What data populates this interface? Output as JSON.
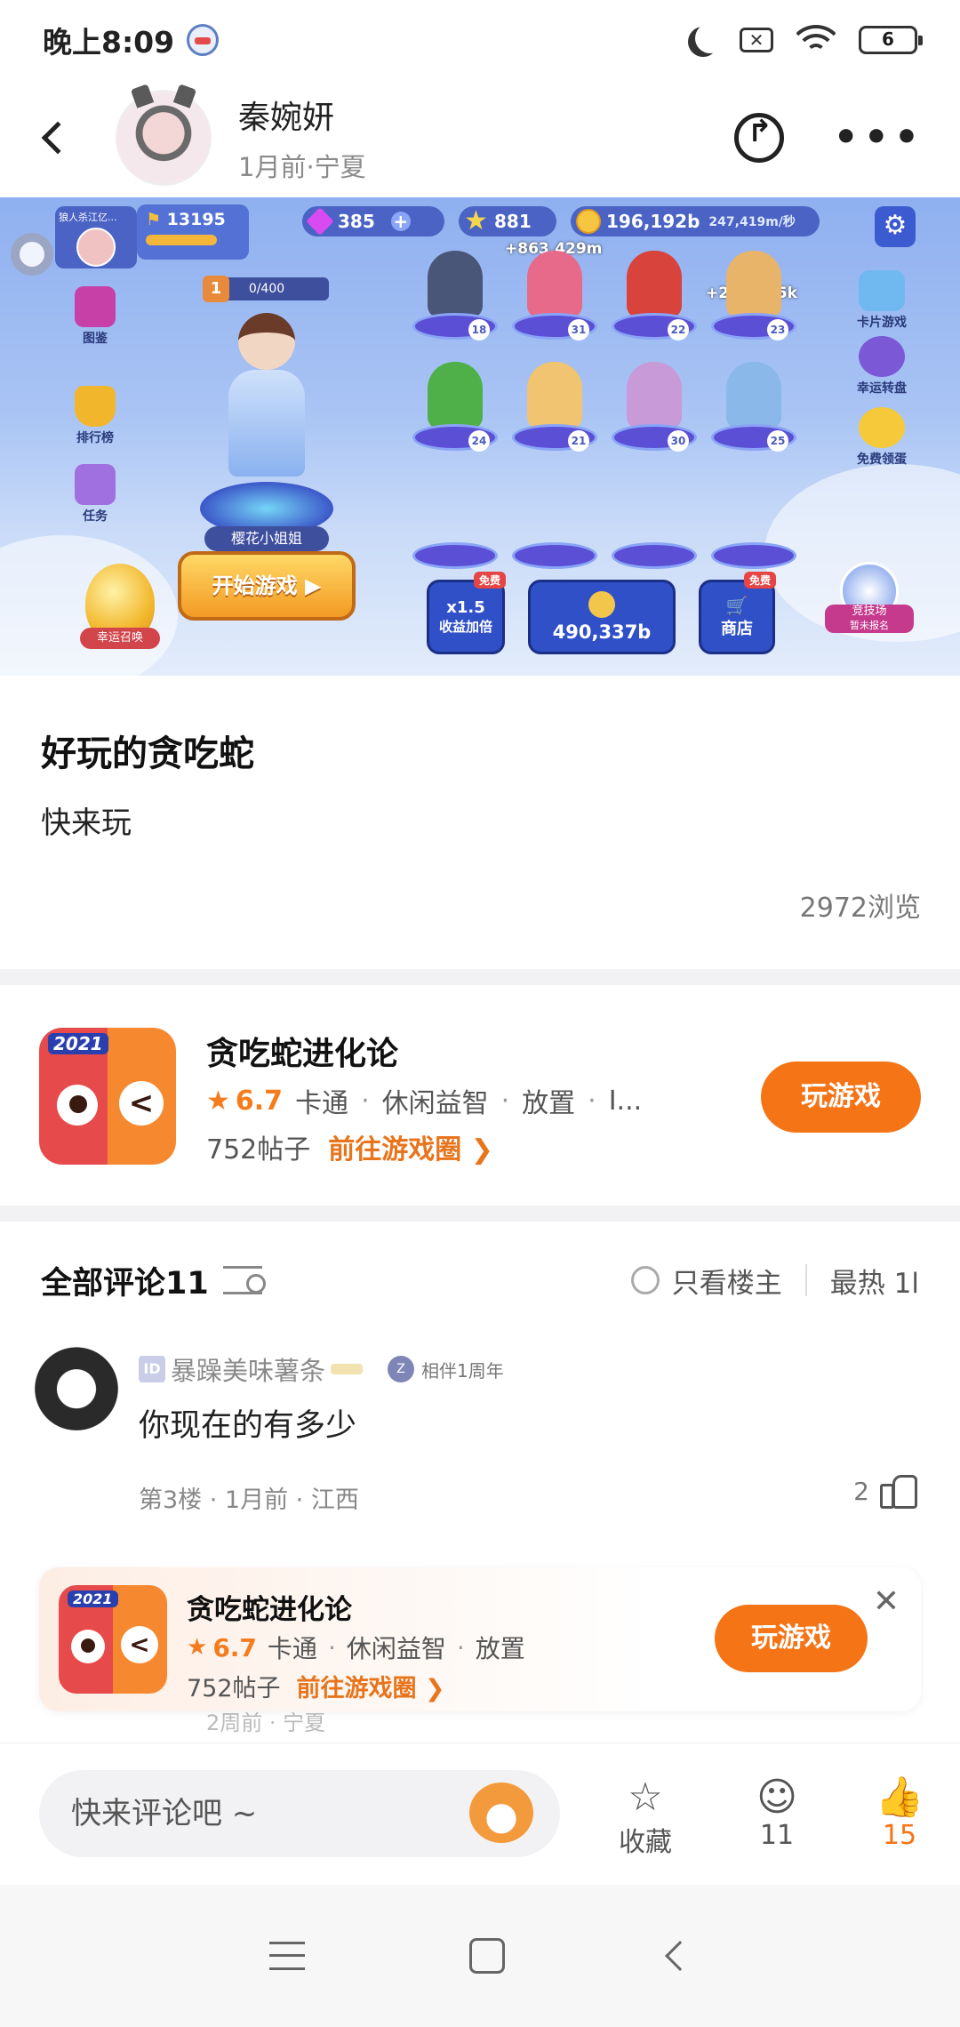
{
  "status_bar": {
    "time": "晚上8:09",
    "battery": "6"
  },
  "header": {
    "user_name": "秦婉妍",
    "meta": "1月前·宁夏"
  },
  "banner": {
    "player_label": "狼人杀江亿...",
    "flag_value": "13195",
    "gems": "385",
    "stars": "881",
    "coins": "196,192b",
    "rate": "247,419m/秒",
    "float_gain_1": "+863,429m",
    "float_gain_2": "+263,545k",
    "stage_num": "1",
    "stage_progress": "0/400",
    "hero_name": "樱花小姐姐",
    "left_menu": [
      "图鉴",
      "排行榜",
      "任务"
    ],
    "right_menu": [
      "卡片游戏",
      "幸运转盘",
      "免费领蛋"
    ],
    "start_button": "开始游戏 ▶",
    "egg_label": "幸运召唤",
    "boost_label": "收益加倍",
    "boost_value": "x1.5",
    "free_tag": "免费",
    "collect_value": "490,337b",
    "shop_label": "商店",
    "arena_label": "竞技场",
    "arena_sub": "暂未报名",
    "char_levels": [
      "18",
      "31",
      "22",
      "23",
      "24",
      "21",
      "30",
      "25"
    ]
  },
  "post": {
    "title": "好玩的贪吃蛇",
    "body": "快来玩",
    "views": "2972浏览"
  },
  "game": {
    "year_badge": "2021",
    "name": "贪吃蛇进化论",
    "rating": "6.7",
    "tags": [
      "卡通",
      "休闲益智",
      "放置",
      "I..."
    ],
    "posts": "752帖子",
    "link": "前往游戏圈 ❯",
    "play": "玩游戏"
  },
  "comments": {
    "title": "全部评论11",
    "only_owner": "只看楼主",
    "sort": "最热 1l",
    "items": [
      {
        "user": "暴躁美味薯条",
        "badge": "相伴1周年",
        "text": "你现在的有多少",
        "meta": "第3楼 · 1月前 · 江西",
        "likes": "2"
      }
    ]
  },
  "float_card": {
    "year_badge": "2021",
    "name": "贪吃蛇进化论",
    "rating": "6.7",
    "tags": [
      "卡通",
      "休闲益智",
      "放置"
    ],
    "posts": "752帖子",
    "link": "前往游戏圈 ❯",
    "play": "玩游戏",
    "close": "✕",
    "peek": "2周前 · 宁夏"
  },
  "action_bar": {
    "input_placeholder": "快来评论吧 ~",
    "favorite": "收藏",
    "comment_count": "11",
    "like_count": "15"
  },
  "colors": {
    "accent": "#f47416",
    "link": "#e8741c"
  }
}
